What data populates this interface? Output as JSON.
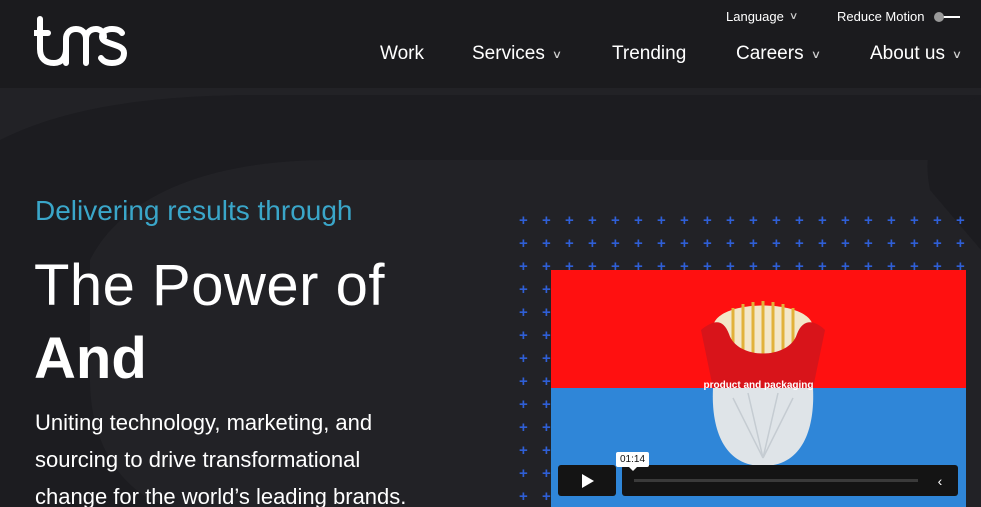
{
  "header": {
    "logo_text": "tms",
    "utility": {
      "language_label": "Language",
      "reduce_motion_label": "Reduce Motion"
    },
    "nav": [
      {
        "label": "Work"
      },
      {
        "label": "Services"
      },
      {
        "label": "Trending"
      },
      {
        "label": "Careers"
      },
      {
        "label": "About us"
      }
    ]
  },
  "hero": {
    "kicker": "Delivering results through",
    "headline_line1": "The Power of",
    "headline_line2": "And",
    "body_line1": "Uniting technology, marketing, and",
    "body_line2": "sourcing to drive transformational",
    "body_line3": "change for the world’s leading brands."
  },
  "video": {
    "caption": "product and packaging",
    "time_tooltip": "01:14",
    "progress": 0.0
  },
  "colors": {
    "background": "#222226",
    "header_bg": "#1b1b1e",
    "kicker": "#3aa6c9",
    "plus_grid": "#2f5fd6",
    "video_red": "#ff1010",
    "video_blue": "#2f86d8"
  },
  "icons": {
    "chevron": "chevron-down-icon",
    "play": "play-icon",
    "back": "chevron-left-icon",
    "toggle": "toggle-switch"
  }
}
